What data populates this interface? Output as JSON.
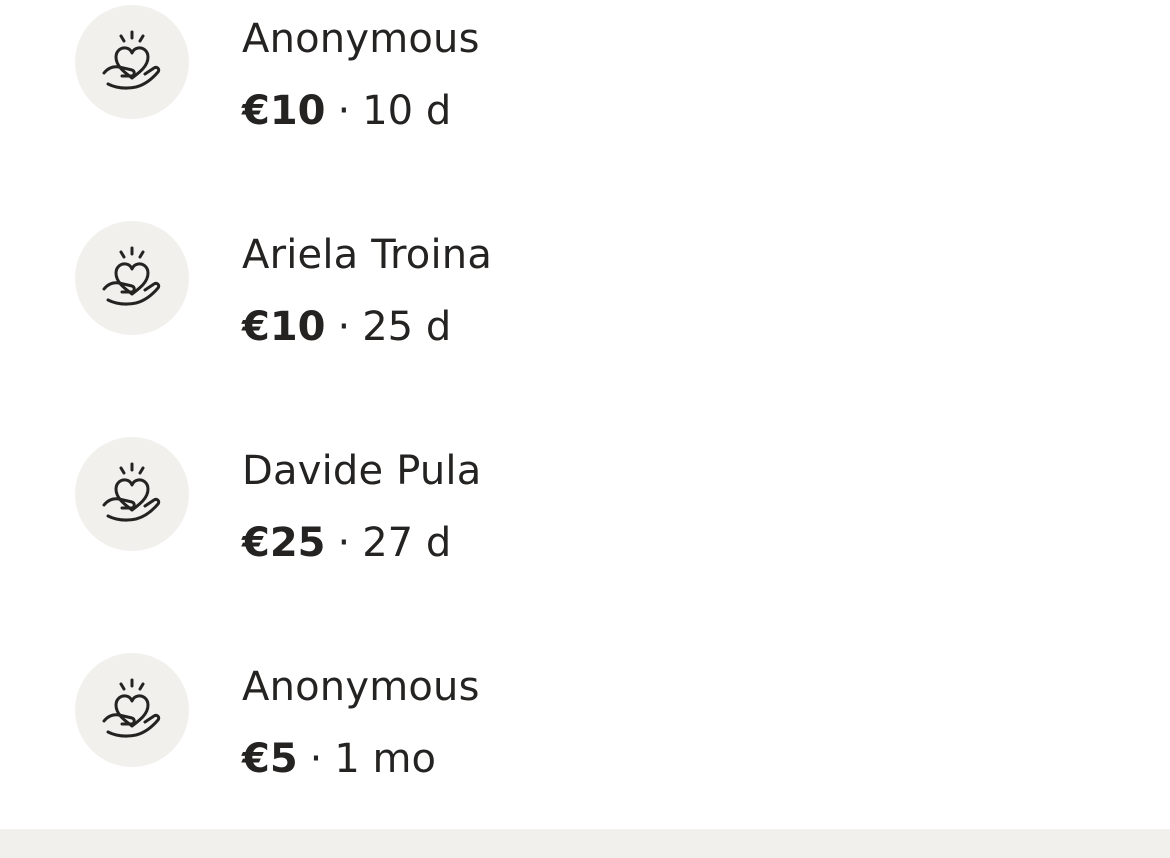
{
  "donations": [
    {
      "name": "Anonymous",
      "amount": "€10",
      "separator": "·",
      "time": "10 d",
      "icon": "heart-in-hand-icon"
    },
    {
      "name": "Ariela Troina",
      "amount": "€10",
      "separator": "·",
      "time": "25 d",
      "icon": "heart-in-hand-icon"
    },
    {
      "name": "Davide Pula",
      "amount": "€25",
      "separator": "·",
      "time": "27 d",
      "icon": "heart-in-hand-icon"
    },
    {
      "name": "Anonymous",
      "amount": "€5",
      "separator": "·",
      "time": "1 mo",
      "icon": "heart-in-hand-icon"
    }
  ],
  "colors": {
    "text": "#252322",
    "avatar_bg": "#f1f0ec",
    "footer_bg": "#f1f0ec"
  }
}
